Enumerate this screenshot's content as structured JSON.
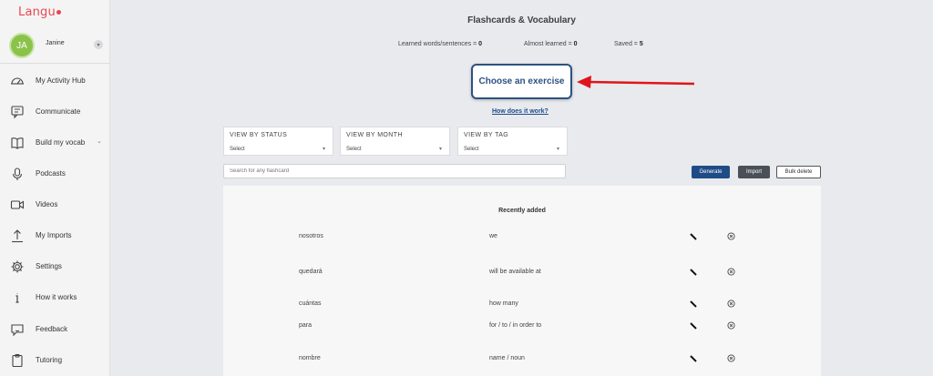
{
  "app": {
    "logo": "Langu"
  },
  "profile": {
    "initials": "JA",
    "name": "Janine"
  },
  "nav": [
    {
      "label": "My Activity Hub",
      "icon": "dashboard-icon"
    },
    {
      "label": "Communicate",
      "icon": "chat-icon"
    },
    {
      "label": "Build my vocab",
      "icon": "book-icon"
    },
    {
      "label": "Podcasts",
      "icon": "microphone-icon"
    },
    {
      "label": "Videos",
      "icon": "video-icon"
    },
    {
      "label": "My Imports",
      "icon": "upload-icon"
    },
    {
      "label": "Settings",
      "icon": "gear-icon"
    },
    {
      "label": "How it works",
      "icon": "info-icon"
    },
    {
      "label": "Feedback",
      "icon": "feedback-icon"
    },
    {
      "label": "Tutoring",
      "icon": "clipboard-icon"
    }
  ],
  "header": {
    "title": "Flashcards & Vocabulary",
    "learned_label": "Learned words/sentences = ",
    "learned_value": "0",
    "almost_label": "Almost learned = ",
    "almost_value": "0",
    "saved_label": "Saved = ",
    "saved_value": "5"
  },
  "exercise": {
    "button_label": "Choose an exercise",
    "help_link": "How does it work?"
  },
  "filters": [
    {
      "label": "VIEW BY STATUS",
      "value": "Select"
    },
    {
      "label": "VIEW BY MONTH",
      "value": "Select"
    },
    {
      "label": "VIEW BY TAG",
      "value": "Select"
    }
  ],
  "search": {
    "placeholder": "Search for any flashcard"
  },
  "actions": {
    "generate": "Generate",
    "import": "Import",
    "bulk_delete": "Bulk delete"
  },
  "list": {
    "title": "Recently added",
    "rows": [
      {
        "word": "nosotros",
        "translation": "we"
      },
      {
        "word": "quedará",
        "translation": "will be available at"
      },
      {
        "word": "cuántas",
        "translation": "how many"
      },
      {
        "word": "para",
        "translation": "for / to / in order to"
      },
      {
        "word": "nombre",
        "translation": "name / noun"
      }
    ]
  },
  "colors": {
    "brand": "#e8474f",
    "accent": "#1f4c86",
    "arrow": "#e0141b"
  }
}
